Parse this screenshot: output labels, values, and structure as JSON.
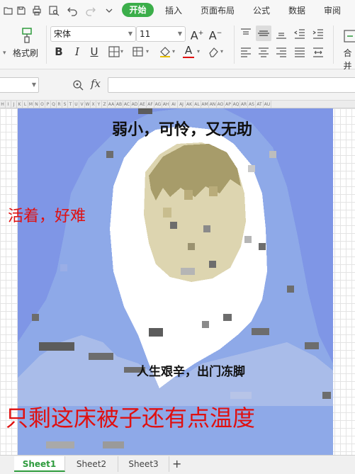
{
  "menu": {
    "tabs": [
      "开始",
      "插入",
      "页面布局",
      "公式",
      "数据",
      "审阅"
    ],
    "active_tab": "开始"
  },
  "ribbon": {
    "format_painter_label": "格式刷",
    "font_name": "宋体",
    "font_size": "11",
    "merge_label": "合并"
  },
  "formula_bar": {
    "fx_label": "fx",
    "cell_reference": "",
    "formula_value": ""
  },
  "column_headers": [
    "H",
    "I",
    "J",
    "K",
    "L",
    "M",
    "N",
    "O",
    "P",
    "Q",
    "R",
    "S",
    "T",
    "U",
    "V",
    "W",
    "X",
    "Y",
    "Z",
    "AA",
    "AB",
    "AC",
    "AD",
    "AE",
    "AF",
    "AG",
    "AH",
    "AI",
    "AJ",
    "AK",
    "AL",
    "AM",
    "AN",
    "AO",
    "AP",
    "AQ",
    "AR",
    "AS",
    "AT",
    "AU"
  ],
  "sheet": {
    "captions": {
      "top": "弱小，可怜，又无助",
      "left": "活着，好难",
      "middle": "人生艰辛，出门冻脚",
      "bottom": "只剩这床被子还有点温度"
    },
    "colors": {
      "blanket_blue": "#8ea9e8",
      "blanket_light": "#b4c6e7",
      "sheet_background": "#7f96e6",
      "hood_white": "#ffffff",
      "face_tan": "#ddd5b0",
      "hair_brown": "#a79c6a",
      "shadow_gray": "#6d6d6d",
      "caption_red": "#e01010",
      "active_green": "#3bae4a"
    }
  },
  "sheet_tabs": [
    "Sheet1",
    "Sheet2",
    "Sheet3"
  ],
  "active_sheet": "Sheet1",
  "add_sheet_label": "+"
}
